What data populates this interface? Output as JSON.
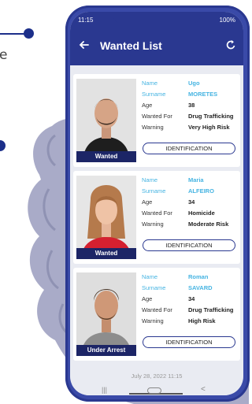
{
  "side_text": "e",
  "status": {
    "time": "11:15",
    "right": "100%"
  },
  "header": {
    "title": "Wanted List"
  },
  "labels": {
    "name": "Name",
    "surname": "Surname",
    "age": "Age",
    "wanted_for": "Wanted For",
    "warning": "Warning",
    "identification": "IDENTIFICATION"
  },
  "cards": [
    {
      "name": "Ugo",
      "surname": "MORETES",
      "age": "38",
      "wanted_for": "Drug Trafficking",
      "warning": "Very High Risk",
      "status": "Wanted"
    },
    {
      "name": "Maria",
      "surname": "ALFEIRO",
      "age": "34",
      "wanted_for": "Homicide",
      "warning": "Moderate Risk",
      "status": "Wanted"
    },
    {
      "name": "Roman",
      "surname": "SAVARD",
      "age": "34",
      "wanted_for": "Drug Trafficking",
      "warning": "High Risk",
      "status": "Under Arrest"
    }
  ],
  "footer": {
    "date": "July 28, 2022 11:15"
  },
  "colors": {
    "primary": "#2a3890",
    "accent": "#46b4e2",
    "label_bg": "#1c2566"
  }
}
